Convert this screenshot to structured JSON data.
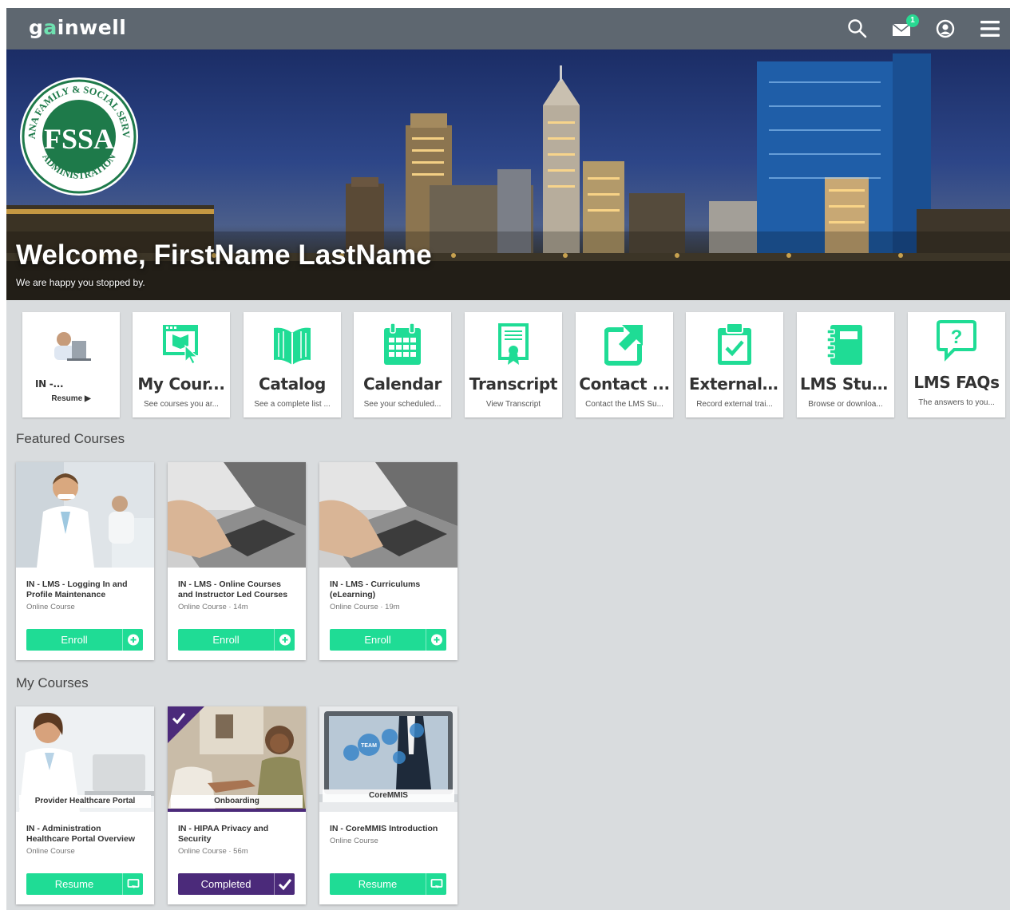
{
  "brand": {
    "logo_prefix": "g",
    "logo_mark": "a",
    "logo_suffix": "inwell",
    "accent_color": "#1fdc95",
    "completed_color": "#4b2a7a"
  },
  "topbar": {
    "icons": [
      "search-icon",
      "mail-icon",
      "user-circle-icon",
      "hamburger-menu-icon"
    ],
    "mail_badge": "1"
  },
  "hero": {
    "seal_top": "INDIANA FAMILY & SOCIAL SERVICES",
    "seal_bottom": "ADMINISTRATION",
    "seal_letters": "FSSA",
    "welcome": "Welcome, FirstName LastName",
    "subtitle": "We are happy you stopped by."
  },
  "tiles": [
    {
      "title": "IN -...",
      "subtitle": "Resume ▶",
      "icon": "course-person-thumbnail"
    },
    {
      "title": "My Cour...",
      "subtitle": "See courses you ar...",
      "icon": "my-courses-icon"
    },
    {
      "title": "Catalog",
      "subtitle": "See a complete list ...",
      "icon": "book-icon"
    },
    {
      "title": "Calendar",
      "subtitle": "See your scheduled...",
      "icon": "calendar-icon"
    },
    {
      "title": "Transcript",
      "subtitle": "View Transcript",
      "icon": "certificate-icon"
    },
    {
      "title": "Contact ...",
      "subtitle": "Contact the LMS Su...",
      "icon": "external-link-icon"
    },
    {
      "title": "External ...",
      "subtitle": "Record external trai...",
      "icon": "clipboard-check-icon"
    },
    {
      "title": "LMS Stud...",
      "subtitle": "Browse or downloa...",
      "icon": "notebook-icon"
    },
    {
      "title": "LMS FAQs",
      "subtitle": "The answers to you...",
      "icon": "question-bubble-icon"
    }
  ],
  "featured": {
    "heading": "Featured Courses",
    "cards": [
      {
        "title": "IN - LMS - Logging In and Profile Maintenance",
        "meta": "Online Course",
        "button": "Enroll",
        "thumb": "dentist-photo"
      },
      {
        "title": "IN - LMS - Online Courses and Instructor Led Courses",
        "meta": "Online Course · 14m",
        "button": "Enroll",
        "thumb": "laptop-typing-photo"
      },
      {
        "title": "IN - LMS - Curriculums (eLearning)",
        "meta": "Online Course · 19m",
        "button": "Enroll",
        "thumb": "laptop-typing-photo"
      }
    ]
  },
  "mycourses": {
    "heading": "My Courses",
    "cards": [
      {
        "title": "IN - Administration Healthcare Portal Overview",
        "meta": "Online Course",
        "button": "Resume",
        "thumb_label": "Provider Healthcare Portal"
      },
      {
        "title": "IN - HIPAA Privacy and Security",
        "meta": "Online Course · 56m",
        "button": "Completed",
        "thumb_label": "Onboarding"
      },
      {
        "title": "IN - CoreMMIS Introduction",
        "meta": "Online Course",
        "button": "Resume",
        "thumb_label": "CoreMMIS",
        "thumb_badge": "TEAM"
      }
    ]
  }
}
